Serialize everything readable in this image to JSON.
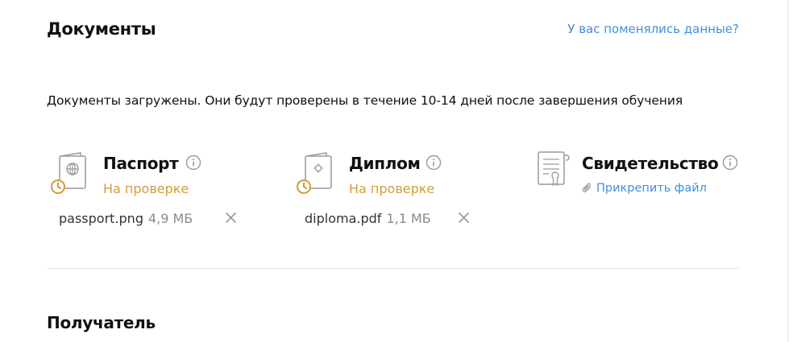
{
  "header": {
    "title": "Документы",
    "change_link": "У вас поменялись данные?"
  },
  "notice": "Документы загружены. Они будут проверены в течение 10-14 дней после завершения обучения",
  "documents": [
    {
      "title": "Паспорт",
      "icon": "passport-icon",
      "status": "На проверке",
      "status_icon": "clock-icon",
      "file": {
        "name": "passport.png",
        "size": "4,9 МБ"
      }
    },
    {
      "title": "Диплом",
      "icon": "diploma-icon",
      "status": "На проверке",
      "status_icon": "clock-icon",
      "file": {
        "name": "diploma.pdf",
        "size": "1,1 МБ"
      }
    },
    {
      "title": "Свидетельство",
      "icon": "certificate-icon",
      "attach_label": "Прикрепить файл",
      "attach_icon": "paperclip-icon"
    }
  ],
  "recipient": {
    "title": "Получатель"
  },
  "colors": {
    "link": "#3f8fe0",
    "pending": "#d39b3c",
    "icon_gray": "#9a9a9a"
  }
}
